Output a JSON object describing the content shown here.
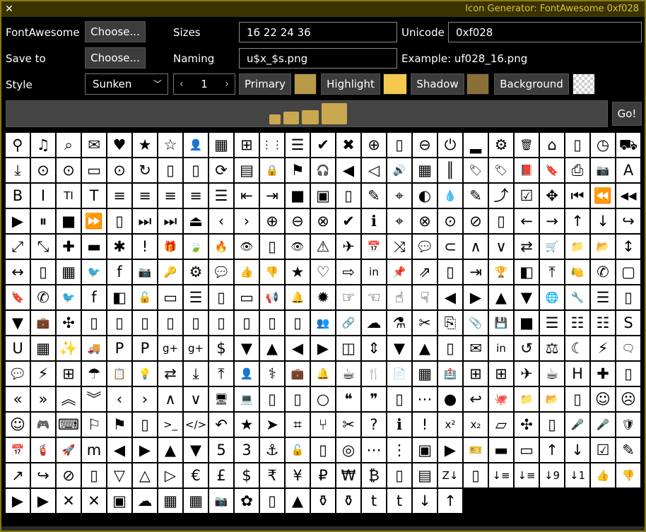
{
  "window": {
    "title": "Icon Generator: FontAwesome 0xf028",
    "close_glyph": "✕"
  },
  "row1": {
    "font_label": "FontAwesome",
    "font_button": "Choose...",
    "sizes_label": "Sizes",
    "sizes_value": "16 22 24 36",
    "unicode_label": "Unicode",
    "unicode_value": "0xf028"
  },
  "row2": {
    "save_label": "Save to",
    "save_button": "Choose...",
    "naming_label": "Naming",
    "naming_value": "u$x_$s.png",
    "example_text": "Example: uf028_16.png"
  },
  "row3": {
    "style_label": "Style",
    "style_value": "Sunken",
    "spin_value": "1",
    "primary_label": "Primary",
    "highlight_label": "Highlight",
    "shadow_label": "Shadow",
    "background_label": "Background"
  },
  "colors": {
    "primary": "#b89a48",
    "highlight": "#f5c850",
    "shadow": "#8a7038",
    "accent": "#d8c040"
  },
  "go_button": "Go!",
  "icons": [
    "⚲",
    "♫",
    "⌕",
    "✉",
    "♥",
    "★",
    "☆",
    "👤",
    "▦",
    "⊞",
    "⋮⋮",
    "☰",
    "✔",
    "✖",
    "⊕",
    "▯",
    "⊖",
    "⏻",
    "▂",
    "⚙",
    "🗑",
    "⌂",
    "▯",
    "◷",
    "⛟",
    "⤓",
    "⊙",
    "⊙",
    "▭",
    "⊙",
    "↻",
    "▯",
    "▯",
    "⟳",
    "▤",
    "🔒",
    "⚑",
    "🎧",
    "◀",
    "◁",
    "🔊",
    "▦",
    "║",
    "🏷",
    "🏷",
    "📕",
    "🔖",
    "⎙",
    "📷",
    "A",
    "B",
    "I",
    "TI",
    "T",
    "≡",
    "≡",
    "≡",
    "≡",
    "☰",
    "⇤",
    "⇥",
    "■",
    "▣",
    "▯",
    "✎",
    "⌖",
    "◐",
    "💧",
    "✎",
    "⤴",
    "☑",
    "✥",
    "⏮",
    "⏪",
    "◀◀",
    "▶",
    "⏸",
    "■",
    "⏩",
    "▯",
    "⏭",
    "⏭",
    "⏏",
    "‹",
    "›",
    "⊕",
    "⊖",
    "⊗",
    "✔",
    "ℹ",
    "⌖",
    "⊗",
    "⊙",
    "⊘",
    "▯",
    "←",
    "→",
    "↑",
    "↓",
    "↪",
    "⤢",
    "⤡",
    "✚",
    "▬",
    "✱",
    "!",
    "🎁",
    "🍃",
    "🔥",
    "👁",
    "▯",
    "👁",
    "⚠",
    "✈",
    "📅",
    "⤨",
    "💬",
    "⊂",
    "∧",
    "∨",
    "⇄",
    "🛒",
    "📁",
    "📂",
    "↕",
    "↔",
    "▯",
    "▦",
    "🐦",
    "f",
    "📷",
    "🔑",
    "⚙",
    "💬",
    "👍",
    "👎",
    "★",
    "♡",
    "⇨",
    "in",
    "📌",
    "⇗",
    "▯",
    "⇥",
    "🏆",
    "◧",
    "⤒",
    "🍋",
    "✆",
    "▢",
    "🔖",
    "✆",
    "🐦",
    "f",
    "◧",
    "🔓",
    "▭",
    "☰",
    "▯",
    "▭",
    "📢",
    "🔔",
    "✹",
    "☞",
    "☜",
    "☝",
    "☟",
    "◀",
    "▶",
    "▲",
    "▼",
    "🌐",
    "🔧",
    "☰",
    "▯",
    "▼",
    "💼",
    "✣",
    "▯",
    "▯",
    "▯",
    "▯",
    "▯",
    "▯",
    "▯",
    "▯",
    "▯",
    "👥",
    "🔗",
    "☁",
    "⚗",
    "✂",
    "⎘",
    "📎",
    "💾",
    "■",
    "☰",
    "☷",
    "☷",
    "S",
    "U",
    "▦",
    "✨",
    "🚚",
    "P",
    "P",
    "g+",
    "g+",
    "$",
    "▼",
    "▲",
    "◀",
    "▶",
    "◫",
    "⇕",
    "▼",
    "▲",
    "▯",
    "✉",
    "in",
    "↺",
    "⚖",
    "☾",
    "⚡",
    "🗨",
    "💬",
    "⚡",
    "⊞",
    "☂",
    "📋",
    "💡",
    "⇄",
    "⤓",
    "⤒",
    "👤",
    "⚕",
    "💼",
    "🔔",
    "☕",
    "🍴",
    "📄",
    "▦",
    "🏥",
    "⊞",
    "⊞",
    "✈",
    "☕",
    "H",
    "✚",
    "▯",
    "«",
    "»",
    "︽",
    "︾",
    "‹",
    "›",
    "∧",
    "∨",
    "🖥",
    "💻",
    "▯",
    "▯",
    "○",
    "❝",
    "❞",
    "▯",
    "⋯",
    "●",
    "↩",
    "🐙",
    "📁",
    "📂",
    "▯",
    "☺",
    "☹",
    "☺",
    "🎮",
    "⌨",
    "⚐",
    "⚑",
    "▯",
    ">_",
    "</>",
    "↶",
    "★",
    "➤",
    "⌗",
    "⑂",
    "✂",
    "?",
    "ℹ",
    "!",
    "x²",
    "x₂",
    "▱",
    "✣",
    "▯",
    "🎤",
    "🎤",
    "🛡",
    "📅",
    "🧯",
    "🚀",
    "m",
    "◀",
    "▶",
    "▲",
    "▼",
    "5",
    "3",
    "⚓",
    "🔓",
    "▯",
    "◎",
    "⋯",
    "⋮",
    "▣",
    "▶",
    "🎫",
    "▬",
    "▭",
    "↑",
    "↓",
    "☑",
    "✎",
    "↗",
    "↪",
    "⊘",
    "▯",
    "▽",
    "△",
    "▷",
    "€",
    "£",
    "$",
    "₹",
    "¥",
    "₽",
    "₩",
    "₿",
    "▯",
    "▤",
    "Z↓",
    "▯",
    "↓≡",
    "↓≡",
    "↓9",
    "↓1",
    "👍",
    "👎",
    "▶",
    "▶",
    "✕",
    "✕",
    "▣",
    "☁",
    "▦",
    "▦",
    "📷",
    "✿",
    "▯",
    "▲",
    "⚱",
    "⚱",
    "t",
    "t",
    "↓",
    "↑"
  ]
}
